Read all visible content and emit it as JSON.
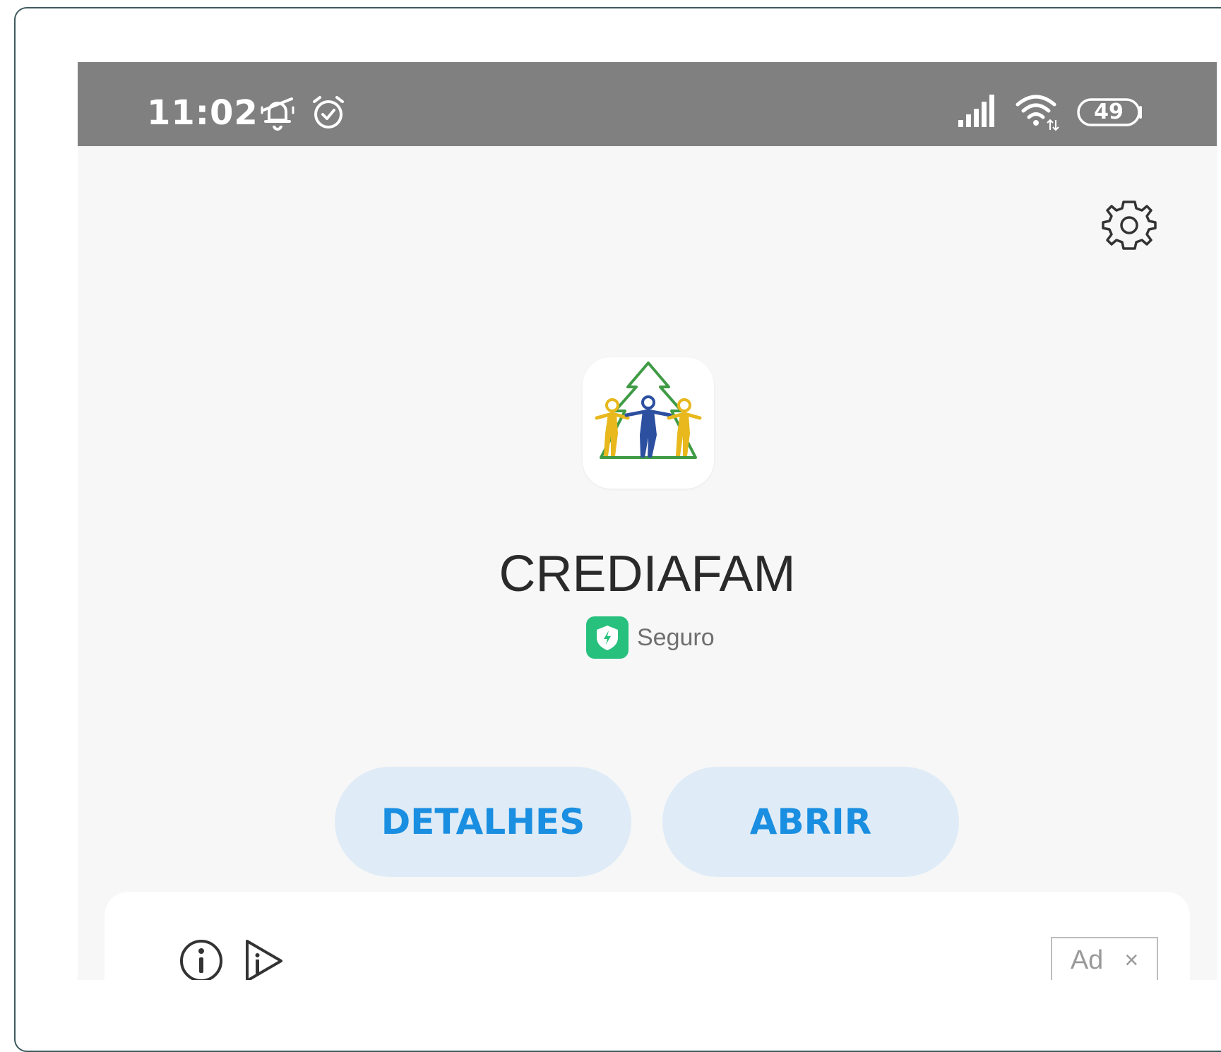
{
  "status_bar": {
    "time": "11:02",
    "battery": "49",
    "icons": [
      "notifications-muted-icon",
      "alarm-icon",
      "signal-icon",
      "wifi-icon",
      "battery-icon"
    ]
  },
  "toolbar": {
    "settings_icon": "gear-icon"
  },
  "app": {
    "name": "CREDIAFAM",
    "safety_label": "Seguro",
    "safety_icon": "shield-icon",
    "safety_color": "#27c07d"
  },
  "actions": {
    "details_label": "DETALHES",
    "open_label": "ABRIR",
    "accent_color": "#1a8ee0"
  },
  "ad": {
    "tag_label": "Ad",
    "close_label": "×",
    "icons": [
      "info-icon",
      "adchoices-icon"
    ]
  }
}
